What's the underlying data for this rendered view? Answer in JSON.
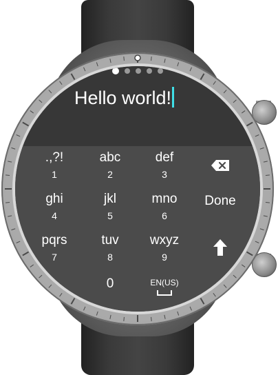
{
  "input": {
    "text": "Hello world!"
  },
  "page_indicator": {
    "count": 5,
    "active_index": 0
  },
  "keyboard": {
    "keys": [
      {
        "label": ".,?!",
        "number": "1"
      },
      {
        "label": "abc",
        "number": "2"
      },
      {
        "label": "def",
        "number": "3"
      },
      {
        "label": "ghi",
        "number": "4"
      },
      {
        "label": "jkl",
        "number": "5"
      },
      {
        "label": "mno",
        "number": "6"
      },
      {
        "label": "pqrs",
        "number": "7"
      },
      {
        "label": "tuv",
        "number": "8"
      },
      {
        "label": "wxyz",
        "number": "9"
      }
    ],
    "zero": "0",
    "language": "EN(US)",
    "done": "Done",
    "backspace_icon": "backspace-icon",
    "shift_icon": "shift-arrow-icon"
  },
  "colors": {
    "cursor": "#3fe0e8",
    "screen_top": "#373737",
    "keyboard_bg": "#4b4b4b",
    "text": "#ffffff"
  }
}
